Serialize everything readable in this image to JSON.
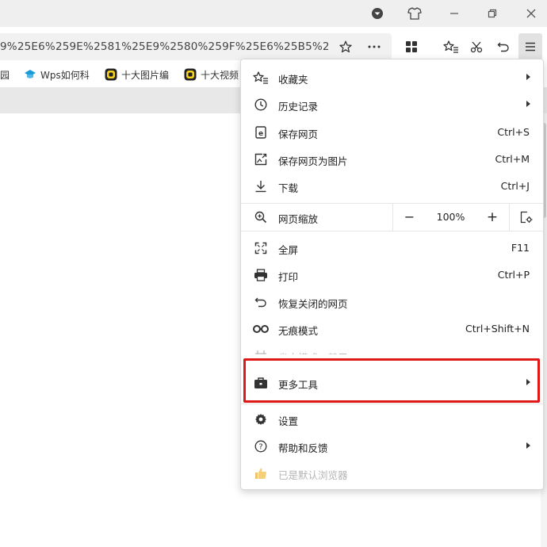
{
  "titlebar": {
    "icons": [
      "shield-download-icon",
      "tshirt-skin-icon",
      "minimize-icon",
      "restore-icon",
      "close-icon"
    ]
  },
  "address_bar": {
    "url_text": "9%25E6%259E%2581%25E9%2580%259F%25E6%25B5%258",
    "icons": [
      "star-icon",
      "more-icon"
    ]
  },
  "toolbar": {
    "icons": [
      "apps-grid-icon",
      "favorites-star-list-icon",
      "scissors-icon",
      "undo-icon",
      "hamburger-menu-icon"
    ]
  },
  "bookmarks": [
    {
      "label": "园"
    },
    {
      "label": "Wps如何科"
    },
    {
      "label": "十大图片编"
    },
    {
      "label": "十大视频"
    }
  ],
  "menu": {
    "items": [
      {
        "label": "收藏夹",
        "shortcut": "",
        "submenu": true
      },
      {
        "label": "历史记录",
        "shortcut": "",
        "submenu": true
      },
      {
        "label": "保存网页",
        "shortcut": "Ctrl+S",
        "submenu": false
      },
      {
        "label": "保存网页为图片",
        "shortcut": "Ctrl+M",
        "submenu": false
      },
      {
        "label": "下载",
        "shortcut": "Ctrl+J",
        "submenu": false
      }
    ],
    "zoom": {
      "label": "网页缩放",
      "minus": "−",
      "value": "100%",
      "plus": "+"
    },
    "items2": [
      {
        "label": "全屏",
        "shortcut": "F11",
        "submenu": false
      },
      {
        "label": "打印",
        "shortcut": "Ctrl+P",
        "submenu": false
      },
      {
        "label": "恢复关闭的网页",
        "shortcut": "",
        "submenu": false
      },
      {
        "label": "无痕模式",
        "shortcut": "Ctrl+Shift+N",
        "submenu": false
      },
      {
        "label": "省电模式：禁用",
        "shortcut": "",
        "submenu": false,
        "disabled": true
      },
      {
        "label": "更多工具",
        "shortcut": "",
        "submenu": true
      }
    ],
    "items3": [
      {
        "label": "设置",
        "shortcut": "",
        "submenu": false
      },
      {
        "label": "帮助和反馈",
        "shortcut": "",
        "submenu": true
      },
      {
        "label": "已是默认浏览器",
        "shortcut": "",
        "submenu": false,
        "disabled": true
      }
    ]
  },
  "colors": {
    "highlight": "#e01818",
    "titlebar": "#efefef",
    "tabstrip": "#e8e8e8"
  }
}
